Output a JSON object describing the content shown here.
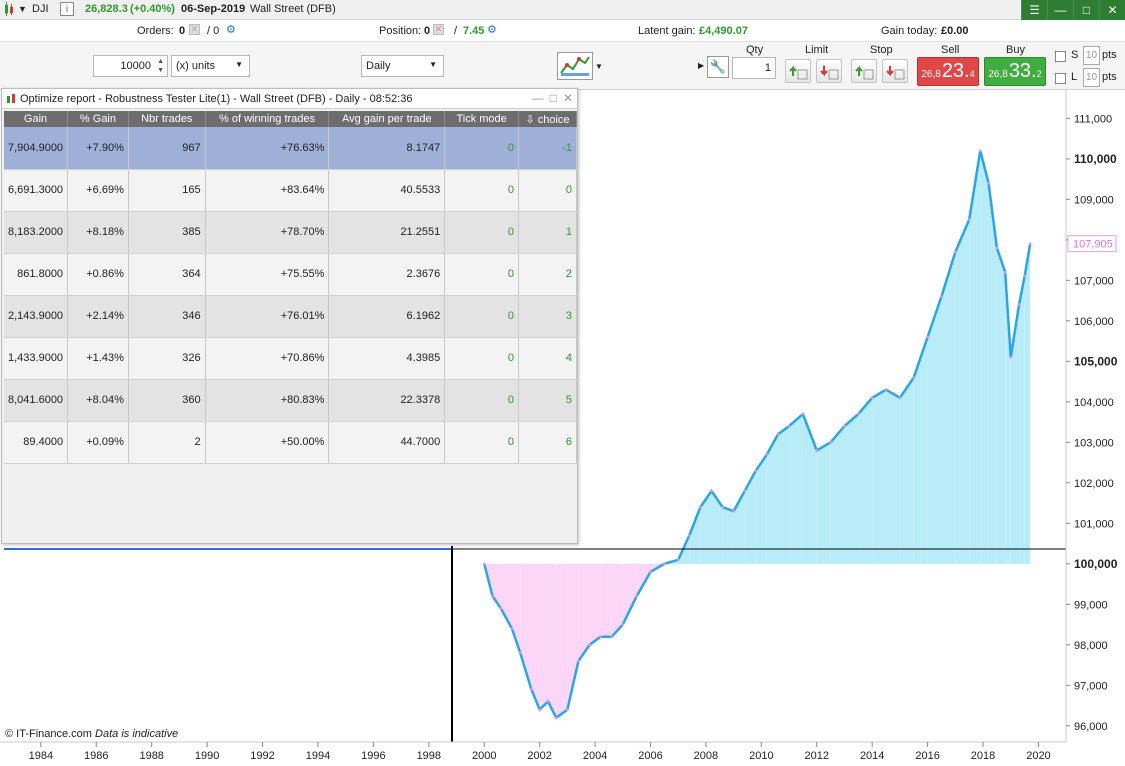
{
  "topbar": {
    "instrument": "DJI",
    "price": "26,828.3",
    "change": "(+0.40%)",
    "date": "06-Sep-2019",
    "market": "Wall Street (DFB)"
  },
  "status": {
    "orders_label": "Orders:",
    "orders_value": "0",
    "orders_sep": "/ 0",
    "position_label": "Position:",
    "position_value": "0",
    "position_sep": "/",
    "position_amount": "7.45",
    "latent_label": "Latent gain:",
    "latent_value": "£4,490.07",
    "gaintoday_label": "Gain today:",
    "gaintoday_value": "£0.00"
  },
  "order": {
    "size_value": "10000",
    "units_label": "(x) units",
    "period_label": "Daily",
    "qty_label": "Qty",
    "qty_value": "1",
    "limit_label": "Limit",
    "stop_label": "Stop",
    "sell_label": "Sell",
    "sell_small": "26,8",
    "sell_big": "23.",
    "sell_sup": "4",
    "buy_label": "Buy",
    "buy_small": "26,8",
    "buy_big": "33.",
    "buy_sup": "2",
    "s_label": "S",
    "l_label": "L",
    "pts_value": "10",
    "pts_label": "pts"
  },
  "report": {
    "title": "Optimize report - Robustness Tester Lite(1) - Wall Street (DFB) - Daily - 08:52:36",
    "columns": [
      "Gain",
      "% Gain",
      "Nbr trades",
      "% of winning trades",
      "Avg gain per trade",
      "Tick mode",
      "⇩ choice"
    ],
    "rows": [
      [
        "7,904.9000",
        "+7.90%",
        "967",
        "+76.63%",
        "8.1747",
        "0",
        "-1"
      ],
      [
        "6,691.3000",
        "+6.69%",
        "165",
        "+83.64%",
        "40.5533",
        "0",
        "0"
      ],
      [
        "8,183.2000",
        "+8.18%",
        "385",
        "+78.70%",
        "21.2551",
        "0",
        "1"
      ],
      [
        "861.8000",
        "+0.86%",
        "364",
        "+75.55%",
        "2.3676",
        "0",
        "2"
      ],
      [
        "2,143.9000",
        "+2.14%",
        "346",
        "+76.01%",
        "6.1962",
        "0",
        "3"
      ],
      [
        "1,433.9000",
        "+1.43%",
        "326",
        "+70.86%",
        "4.3985",
        "0",
        "4"
      ],
      [
        "8,041.6000",
        "+8.04%",
        "360",
        "+80.83%",
        "22.3378",
        "0",
        "5"
      ],
      [
        "89.4000",
        "+0.09%",
        "2",
        "+50.00%",
        "44.7000",
        "0",
        "6"
      ]
    ]
  },
  "copyright": {
    "text": "© IT-Finance.com",
    "note": "Data is indicative"
  },
  "chart_data": {
    "type": "area",
    "title": "",
    "xlabel": "",
    "ylabel": "",
    "baseline": 100000,
    "ylim": [
      95600,
      111700
    ],
    "y_ticks": [
      96000,
      97000,
      98000,
      99000,
      100000,
      101000,
      102000,
      103000,
      104000,
      105000,
      106000,
      107000,
      108000,
      109000,
      110000,
      111000
    ],
    "y_tick_labels": [
      "96,000",
      "97,000",
      "98,000",
      "99,000",
      "100,000",
      "101,000",
      "102,000",
      "103,000",
      "104,000",
      "105,000",
      "106,000",
      "107,000",
      "108,000",
      "109,000",
      "110,000",
      "111,000"
    ],
    "y_bold_ticks": [
      100000,
      105000,
      110000
    ],
    "last_value_label": "107,905",
    "x_ticks": [
      "1984",
      "1986",
      "1988",
      "1990",
      "1992",
      "1994",
      "1996",
      "1998",
      "2000",
      "2002",
      "2004",
      "2006",
      "2008",
      "2010",
      "2012",
      "2014",
      "2016",
      "2018",
      "2020"
    ],
    "series": [
      {
        "x": [
          2000.0,
          2000.3,
          2000.6,
          2001.0,
          2001.3,
          2001.7,
          2002.0,
          2002.3,
          2002.6,
          2003.0,
          2003.4,
          2003.8,
          2004.2,
          2004.6,
          2005.0,
          2005.5,
          2006.0,
          2006.5,
          2007.0,
          2007.4,
          2007.8,
          2008.2,
          2008.6,
          2009.0,
          2009.4,
          2009.8,
          2010.2,
          2010.6,
          2011.0,
          2011.5,
          2012.0,
          2012.5,
          2013.0,
          2013.5,
          2014.0,
          2014.5,
          2015.0,
          2015.5,
          2016.0,
          2016.5,
          2017.0,
          2017.5,
          2017.9,
          2018.2,
          2018.5,
          2018.8,
          2019.0,
          2019.3,
          2019.5,
          2019.7
        ],
        "y": [
          100000,
          99200,
          98900,
          98400,
          97800,
          96900,
          96400,
          96600,
          96200,
          96400,
          97600,
          98000,
          98200,
          98200,
          98500,
          99200,
          99800,
          100000,
          100100,
          100700,
          101400,
          101800,
          101400,
          101300,
          101800,
          102300,
          102700,
          103200,
          103400,
          103700,
          102800,
          103000,
          103400,
          103700,
          104100,
          104300,
          104100,
          104600,
          105600,
          106600,
          107700,
          108500,
          110200,
          109400,
          107800,
          107200,
          105100,
          106400,
          107100,
          107905
        ]
      }
    ]
  }
}
